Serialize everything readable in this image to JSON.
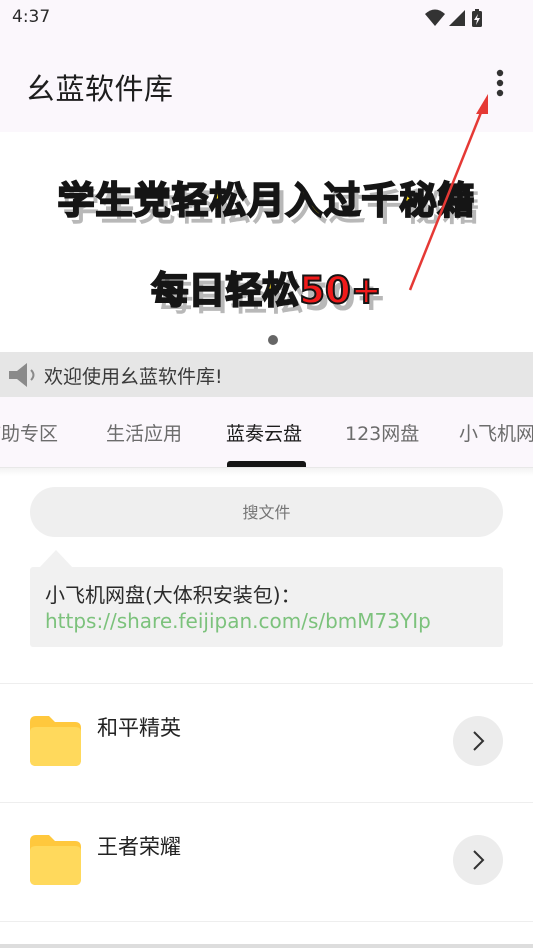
{
  "status_bar": {
    "time": "4:37",
    "icons": [
      "wifi-icon",
      "signal-icon",
      "battery-charging-icon"
    ]
  },
  "app_bar": {
    "title": "幺蓝软件库",
    "menu_icon": "more-vert-icon"
  },
  "banner": {
    "line1": "学生党轻松月入过千秘籍",
    "line2_prefix": "每日轻松",
    "line2_accent": "50+",
    "active_page": 1,
    "colors": {
      "text": "#ffe11b",
      "accent": "#f11a1a",
      "outline": "#151515"
    }
  },
  "notice": {
    "icon": "speaker-icon",
    "text": "欢迎使用幺蓝软件库!"
  },
  "tabs": [
    {
      "label": "辅助专区",
      "active": false
    },
    {
      "label": "生活应用",
      "active": false
    },
    {
      "label": "蓝奏云盘",
      "active": true
    },
    {
      "label": "123网盘",
      "active": false
    },
    {
      "label": "小飞机网盘",
      "active": false
    }
  ],
  "search": {
    "placeholder": "搜文件"
  },
  "info_card": {
    "title": "小飞机网盘(大体积安装包)：",
    "link": "https://share.feijipan.com/s/bmM73YIp",
    "link_color": "#7cc27c"
  },
  "items": [
    {
      "name": "和平精英",
      "icon": "folder-icon",
      "action_icon": "chevron-right-icon"
    },
    {
      "name": "王者荣耀",
      "icon": "folder-icon",
      "action_icon": "chevron-right-icon"
    }
  ],
  "colors": {
    "app_background": "#fbf7fc",
    "folder": "#ffd54f",
    "annotation_arrow": "#e53935"
  }
}
